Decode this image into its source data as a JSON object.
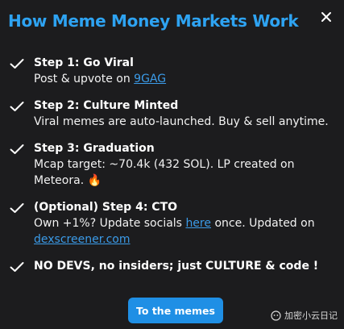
{
  "modal": {
    "title": "How Meme Money Markets Work",
    "close_icon": "close-icon"
  },
  "steps": [
    {
      "heading": "Step 1: Go Viral",
      "desc_before": "Post & upvote on ",
      "link": "9GAG",
      "desc_after": ""
    },
    {
      "heading": "Step 2: Culture Minted",
      "desc": "Viral memes are auto-launched. Buy & sell anytime."
    },
    {
      "heading": "Step 3: Graduation",
      "desc": "Mcap target: ~70.4k (432 SOL). LP created on Meteora.",
      "emoji": "🔥"
    },
    {
      "heading": "(Optional) Step 4: CTO",
      "desc_before": "Own +1%? Update socials ",
      "link": "here",
      "desc_middle": " once. Updated on ",
      "link2": "dexscreener.com"
    },
    {
      "heading": "NO DEVS, no insiders; just CULTURE & code !"
    }
  ],
  "cta": {
    "label": "To the memes"
  },
  "watermark": {
    "text": "加密小云日记",
    "icon": "wechat-icon"
  },
  "colors": {
    "background": "#1c1c1e",
    "title": "#2ea3f2",
    "link": "#3b9be8",
    "button": "#1f8fe5"
  }
}
